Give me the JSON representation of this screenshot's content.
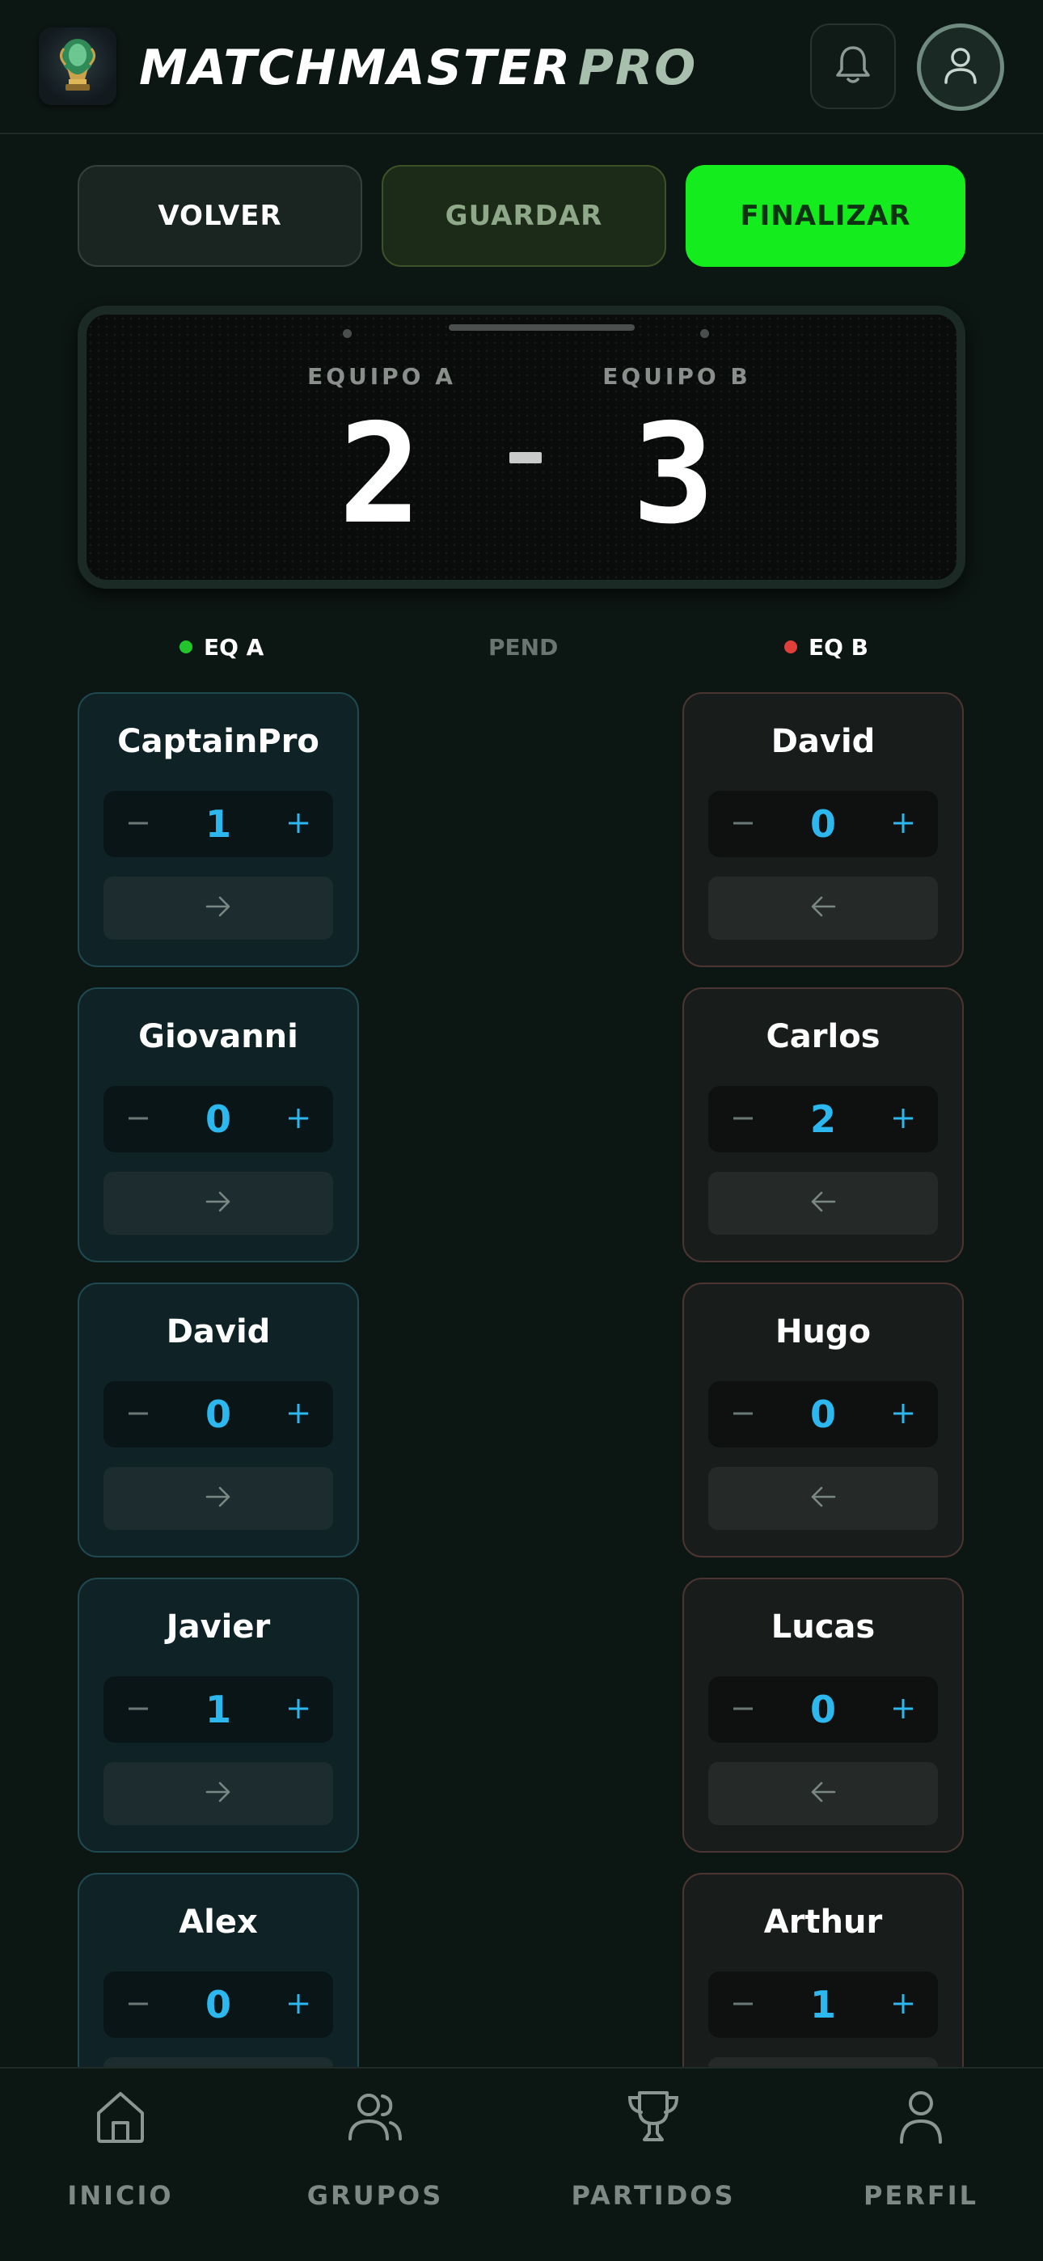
{
  "header": {
    "title_main": "MATCHMASTER",
    "title_accent": "PRO"
  },
  "actions": {
    "back": "VOLVER",
    "save": "GUARDAR",
    "finish": "FINALIZAR"
  },
  "scoreboard": {
    "team_a_label": "EQUIPO A",
    "team_b_label": "EQUIPO B",
    "team_a_score": "2",
    "team_b_score": "3"
  },
  "status": {
    "team_a": "EQ A",
    "pending": "PEND",
    "team_b": "EQ B",
    "team_a_color": "#22c52e",
    "team_b_color": "#e0403c"
  },
  "team_a_players": [
    {
      "name": "CaptainPro",
      "goals": "1"
    },
    {
      "name": "Giovanni",
      "goals": "0"
    },
    {
      "name": "David",
      "goals": "0"
    },
    {
      "name": "Javier",
      "goals": "1"
    },
    {
      "name": "Alex",
      "goals": "0"
    }
  ],
  "team_b_players": [
    {
      "name": "David",
      "goals": "0"
    },
    {
      "name": "Carlos",
      "goals": "2"
    },
    {
      "name": "Hugo",
      "goals": "0"
    },
    {
      "name": "Lucas",
      "goals": "0"
    },
    {
      "name": "Arthur",
      "goals": "1"
    }
  ],
  "nav": {
    "home": "INICIO",
    "groups": "GRUPOS",
    "matches": "PARTIDOS",
    "profile": "PERFIL"
  },
  "colors": {
    "accent_green": "#15ec1d",
    "goal_blue": "#2cb8ee"
  },
  "icons": {
    "logo": "trophy-logo-icon",
    "bell": "bell-icon",
    "avatar": "user-icon",
    "decrement": "minus-icon",
    "increment": "plus-icon",
    "move_to_b": "arrow-right-icon",
    "move_to_a": "arrow-left-icon"
  }
}
